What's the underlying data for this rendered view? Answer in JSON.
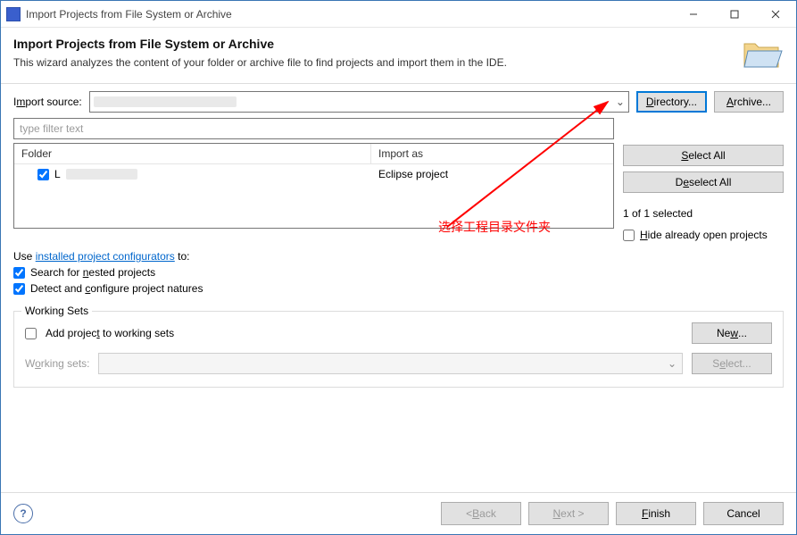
{
  "window": {
    "title": "Import Projects from File System or Archive",
    "min_tooltip": "Minimize",
    "max_tooltip": "Maximize",
    "close_tooltip": "Close"
  },
  "header": {
    "title": "Import Projects from File System or Archive",
    "desc": "This wizard analyzes the content of your folder or archive file to find projects and import them in the IDE."
  },
  "source": {
    "label_prefix": "I",
    "label_u": "m",
    "label_suffix": "port source:",
    "value_placeholder": "",
    "btn_dir_prefix": "",
    "btn_dir_u": "D",
    "btn_dir_suffix": "irectory...",
    "btn_arch_prefix": "",
    "btn_arch_u": "A",
    "btn_arch_suffix": "rchive..."
  },
  "filter": {
    "placeholder": "type filter text"
  },
  "table": {
    "col_folder": "Folder",
    "col_import": "Import as",
    "rows": [
      {
        "checked": true,
        "name_prefix": "L",
        "import_as": "Eclipse project"
      }
    ]
  },
  "buttons": {
    "select_all_prefix": "",
    "select_all_u": "S",
    "select_all_suffix": "elect All",
    "deselect_all_prefix": "D",
    "deselect_all_u": "e",
    "deselect_all_suffix": "select All"
  },
  "status": {
    "selected": "1 of 1 selected"
  },
  "hide": {
    "prefix": "",
    "u": "H",
    "suffix": "ide already open projects",
    "checked": false
  },
  "config": {
    "prefix": "Use ",
    "link": "installed project configurators",
    "suffix": " to:",
    "nested": {
      "checked": true,
      "prefix": "Search for ",
      "u": "n",
      "suffix": "ested projects"
    },
    "natures": {
      "checked": true,
      "prefix": "Detect and ",
      "u": "c",
      "suffix": "onfigure project natures"
    }
  },
  "ws": {
    "legend": "Working Sets",
    "add": {
      "checked": false,
      "prefix": "Add projec",
      "u": "t",
      "suffix": " to working sets"
    },
    "new_prefix": "Ne",
    "new_u": "w",
    "new_suffix": "...",
    "sets_label_prefix": "W",
    "sets_label_u": "o",
    "sets_label_suffix": "rking sets:",
    "select_prefix": "S",
    "select_u": "e",
    "select_suffix": "lect..."
  },
  "annotation": {
    "text": "选择工程目录文件夹"
  },
  "footer": {
    "back_prefix": "< ",
    "back_u": "B",
    "back_suffix": "ack",
    "next_prefix": "",
    "next_u": "N",
    "next_suffix": "ext >",
    "finish_prefix": "",
    "finish_u": "F",
    "finish_suffix": "inish",
    "cancel": "Cancel"
  }
}
